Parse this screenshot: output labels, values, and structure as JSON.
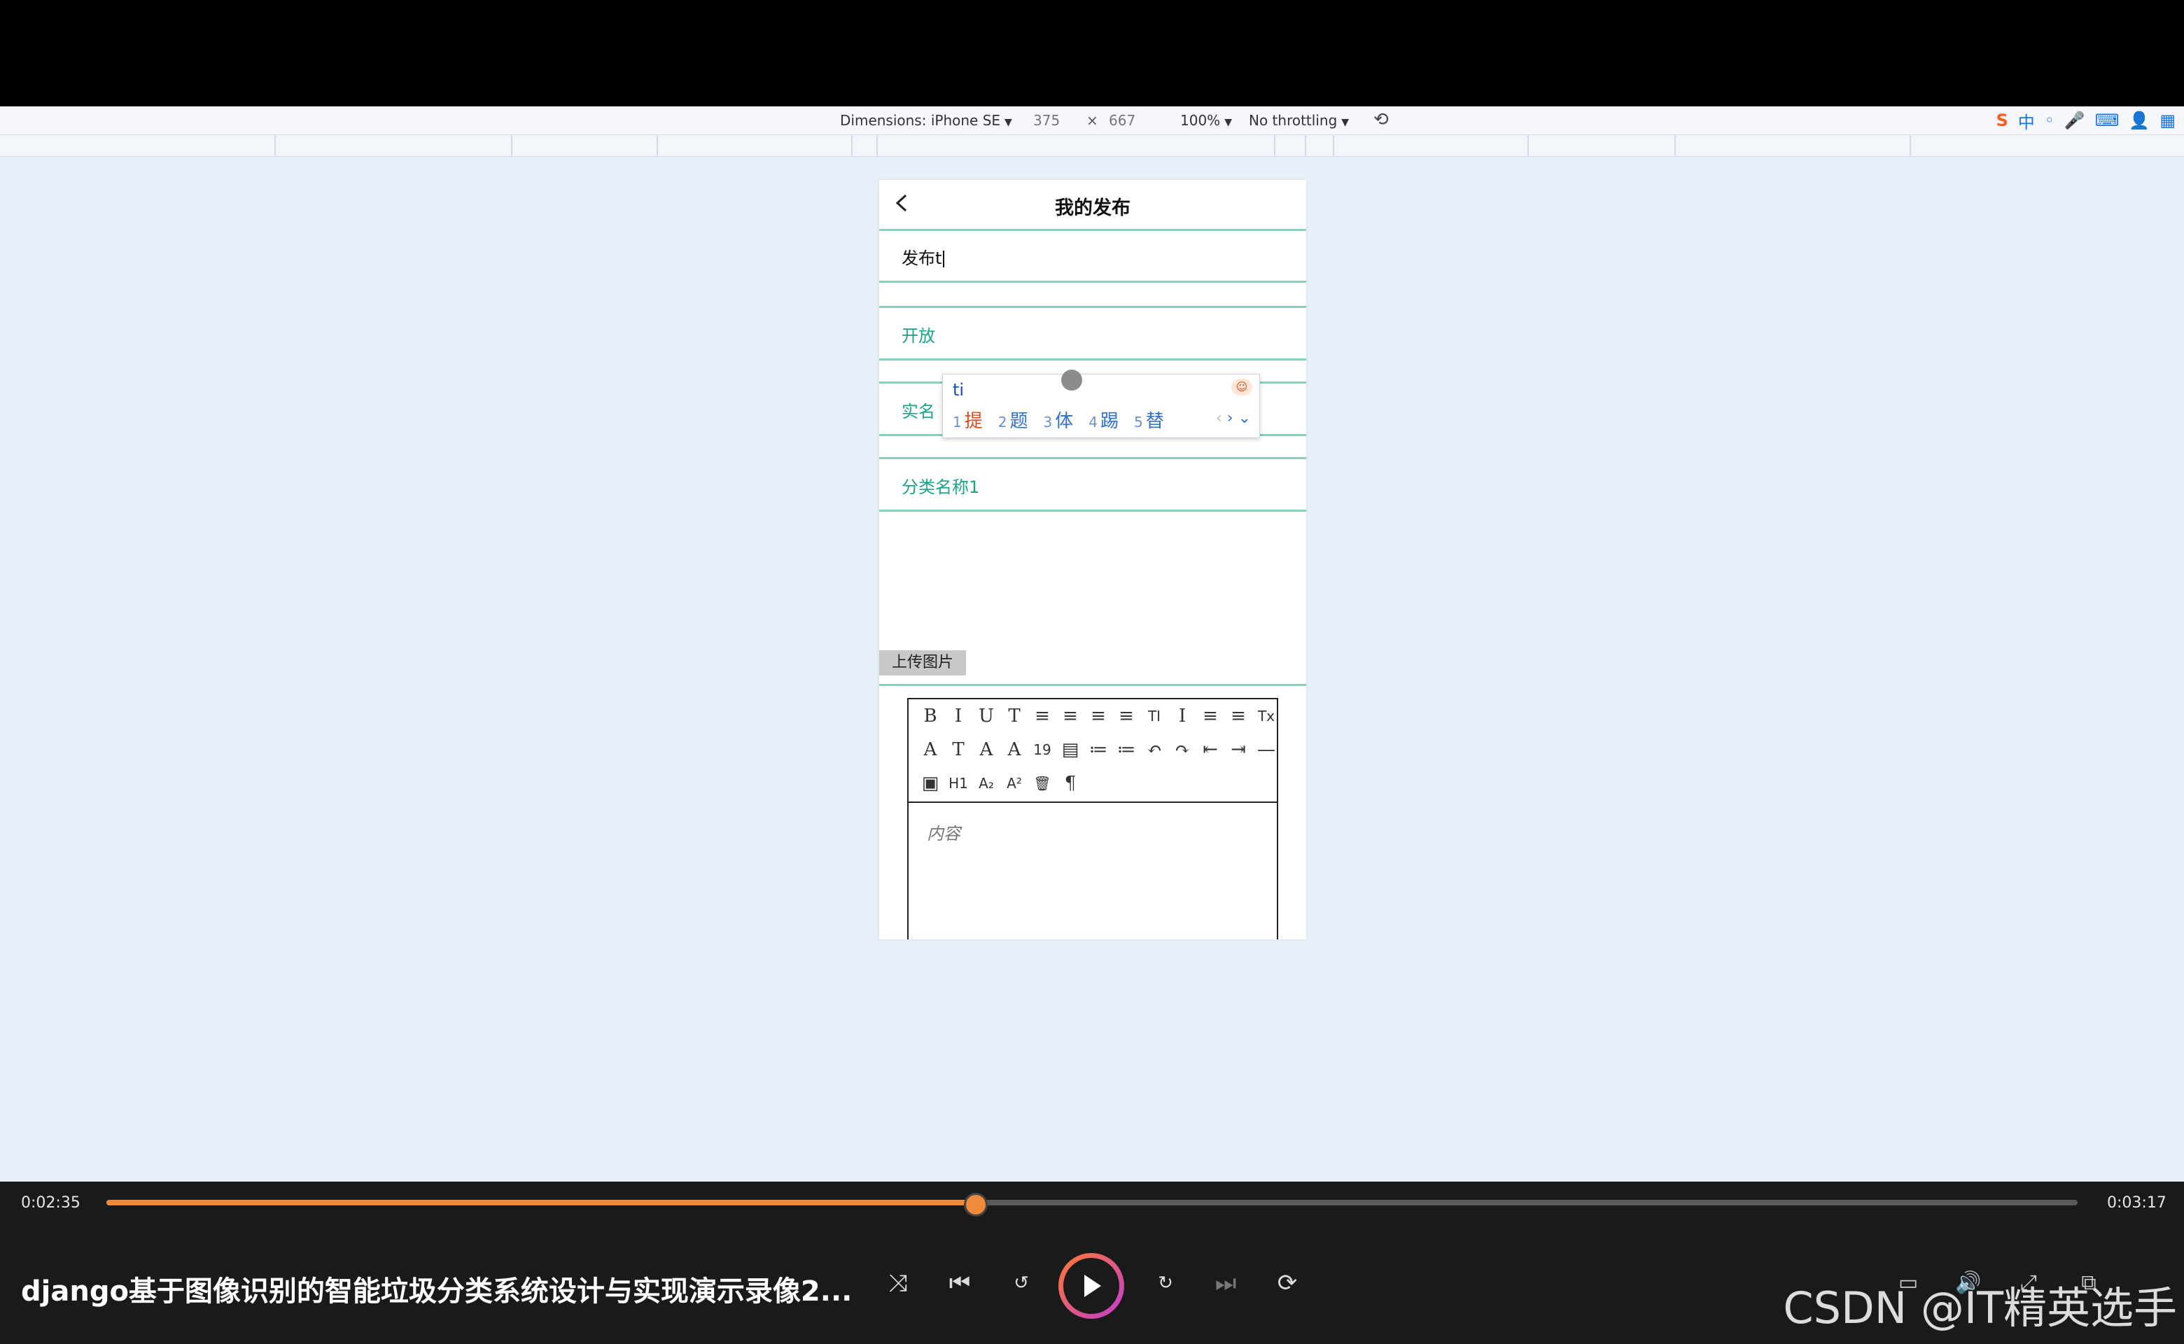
{
  "devtools": {
    "dimensions_label": "Dimensions: iPhone SE",
    "width": "375",
    "times": "×",
    "height": "667",
    "zoom": "100%",
    "throttling": "No throttling"
  },
  "ime_tray": {
    "s_logo": "S",
    "mode": "中"
  },
  "page": {
    "title": "我的发布",
    "title_field_value": "发布t",
    "field_open": "开放",
    "field_realname": "实名",
    "field_category": "分类名称1",
    "upload_button": "上传图片",
    "editor_placeholder": "内容",
    "toolbar_row1": [
      "B",
      "I",
      "U",
      "T",
      "≡",
      "≡",
      "≡",
      "≡",
      "TI",
      "I",
      "≡",
      "≡",
      "Tx"
    ],
    "toolbar_row2": [
      "A",
      "T",
      "A",
      "A",
      "19",
      "▤",
      "≔",
      "≔",
      "↶",
      "↷",
      "⇤",
      "⇥",
      "—"
    ],
    "toolbar_row3": [
      "▣",
      "H1",
      "A₂",
      "A²",
      "🗑",
      "¶"
    ]
  },
  "ime_popup": {
    "input": "ti",
    "candidates": [
      {
        "num": "1",
        "text": "提"
      },
      {
        "num": "2",
        "text": "题"
      },
      {
        "num": "3",
        "text": "体"
      },
      {
        "num": "4",
        "text": "踢"
      },
      {
        "num": "5",
        "text": "替"
      }
    ]
  },
  "player": {
    "current_time": "0:02:35",
    "total_time": "0:03:17",
    "progress": 0.44,
    "video_title": "django基于图像识别的智能垃圾分类系统设计与实现演示录像2...",
    "watermark": "CSDN @IT精英选手",
    "accent_color": "#f08a3c"
  }
}
